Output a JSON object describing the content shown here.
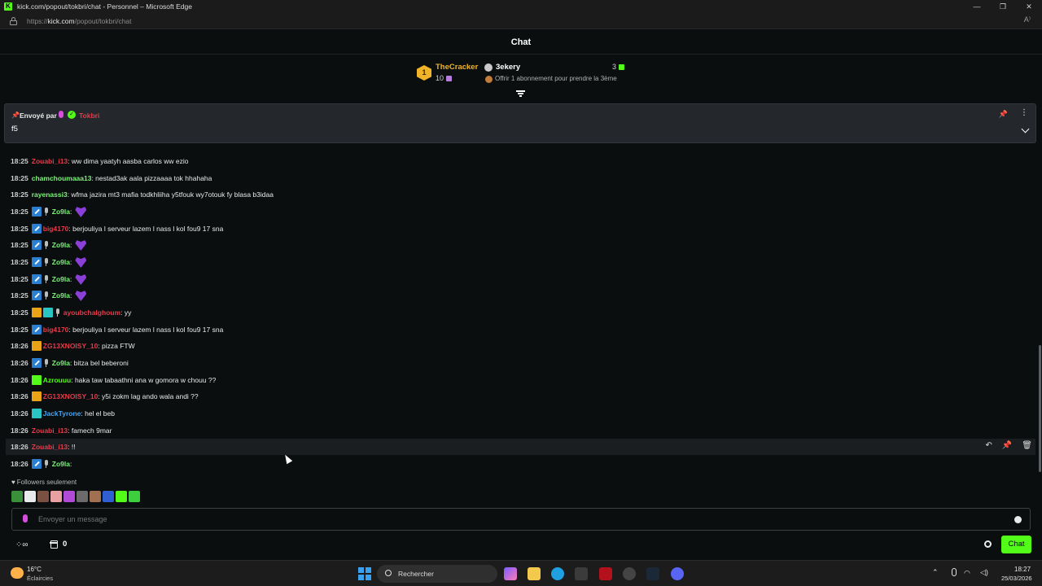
{
  "window": {
    "title": "kick.com/popout/tokbri/chat - Personnel – Microsoft Edge",
    "url_prefix": "https://",
    "url_host": "kick.com",
    "url_path": "/popout/tokbri/chat"
  },
  "chat": {
    "title": "Chat"
  },
  "leaderboard": {
    "first": {
      "rank": "1",
      "name": "TheCracker",
      "count": "10"
    },
    "second": {
      "name": "3ekery",
      "count": "3",
      "offer": "Offrir 1 abonnement pour prendre la 3ème"
    }
  },
  "pinned": {
    "sent_by": "Envoyé par",
    "user": "Tokbri",
    "message": "f5"
  },
  "messages": [
    {
      "time": "18:25",
      "user": "Zouabi_i13",
      "text": ": ww dima yaatyh aasba carlos ww ezio",
      "user_color": "red"
    },
    {
      "time": "18:25",
      "user": "chamchoumaaa13",
      "text": ": nestad3ak aala pizzaaaa tok hhahaha",
      "user_color": "green"
    },
    {
      "time": "18:25",
      "user": "rayenassi3",
      "text": ": wfma jazira mt3 mafia todkhliiha y5tfouk wy7otouk fy blasa b3idaa",
      "user_color": "green"
    },
    {
      "time": "18:25",
      "user": "Zo9la",
      "text": ":",
      "user_color": "green"
    },
    {
      "time": "18:25",
      "user": "big4170",
      "text": ": berjouliya l serveur lazem l nass l kol fou9 17 sna",
      "user_color": "red"
    },
    {
      "time": "18:25",
      "user": "Zo9la",
      "text": ":",
      "user_color": "green"
    },
    {
      "time": "18:25",
      "user": "Zo9la",
      "text": ":",
      "user_color": "green"
    },
    {
      "time": "18:25",
      "user": "Zo9la",
      "text": ":",
      "user_color": "green"
    },
    {
      "time": "18:25",
      "user": "Zo9la",
      "text": ":",
      "user_color": "green"
    },
    {
      "time": "18:25",
      "user": "ayoubchalghoum",
      "text": ": yy",
      "user_color": "red"
    },
    {
      "time": "18:25",
      "user": "big4170",
      "text": ": berjouliya l serveur lazem l nass l kol fou9 17 sna",
      "user_color": "red"
    },
    {
      "time": "18:26",
      "user": "ZG13XNOISY_10",
      "text": ": pizza FTW",
      "user_color": "red"
    },
    {
      "time": "18:26",
      "user": "Zo9la",
      "text": ": bitza bel beberoni",
      "user_color": "green"
    },
    {
      "time": "18:26",
      "user": "Azrouuu",
      "text": ": haka taw tabaathni ana w gomora w chouu ??",
      "user_color": "lime"
    },
    {
      "time": "18:26",
      "user": "ZG13XNOISY_10",
      "text": ": y5i zokm lag ando wala andi ??",
      "user_color": "red"
    },
    {
      "time": "18:26",
      "user": "JackTyrone",
      "text": ": hel el beb",
      "user_color": "blue"
    },
    {
      "time": "18:26",
      "user": "Zouabi_i13",
      "text": ": famech 9mar",
      "user_color": "red"
    },
    {
      "time": "18:26",
      "user": "Zouabi_i13",
      "text": ": !!",
      "user_color": "red"
    },
    {
      "time": "18:26",
      "user": "Zo9la",
      "text": ":",
      "user_color": "green"
    }
  ],
  "followers_only": "Followers seulement",
  "input": {
    "placeholder": "Envoyer un message"
  },
  "bottom": {
    "gift_count": "0",
    "chat_button": "Chat"
  },
  "taskbar": {
    "temperature": "16°C",
    "weather": "Éclaircies",
    "search": "Rechercher",
    "time": "18:27",
    "date": "25/03/2026"
  },
  "colors": {
    "accent": "#53fc18",
    "red_user": "#e53b4b",
    "green_user": "#7cf27a",
    "blue_user": "#43a5f5",
    "gold": "#f0b429"
  }
}
